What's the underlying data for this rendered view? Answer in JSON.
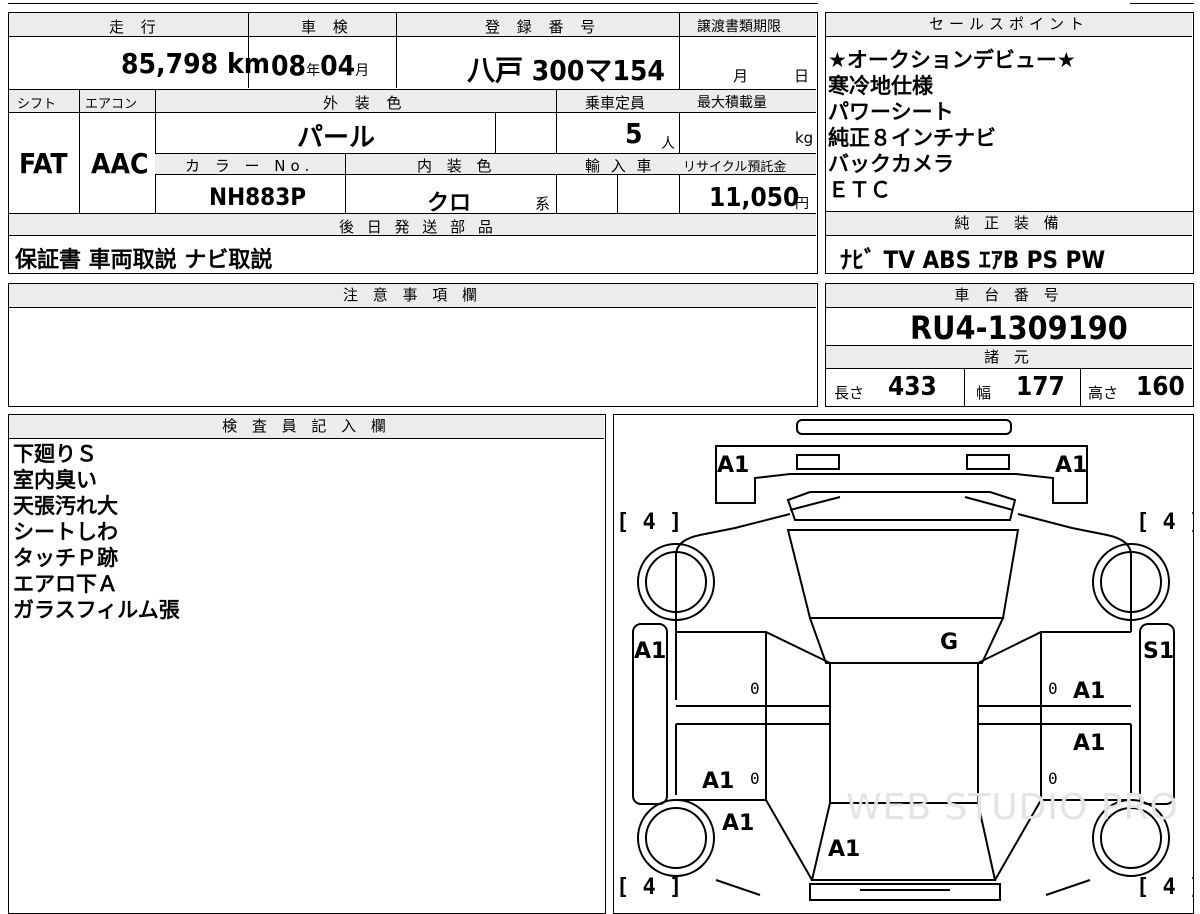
{
  "top_section": {
    "mileage": {
      "header": "走 行",
      "value": "85,798",
      "unit": "km"
    },
    "inspection": {
      "header": "車 検",
      "year": "08",
      "year_unit": "年",
      "month": "04",
      "month_unit": "月"
    },
    "registration": {
      "header": "登 録 番 号",
      "value": "八戸 300マ154"
    },
    "transfer_deadline": {
      "header": "譲渡書類期限",
      "month_unit": "月",
      "day_unit": "日"
    },
    "shift": {
      "header": "シフト",
      "value": "FAT"
    },
    "aircon": {
      "header": "エアコン",
      "value": "AAC"
    },
    "exterior_color": {
      "header": "外 装 色",
      "value": "パール"
    },
    "capacity": {
      "header": "乗車定員",
      "value": "5",
      "unit": "人"
    },
    "max_load": {
      "header": "最大積載量",
      "unit": "kg"
    },
    "color_no": {
      "header": "カ ラ ー No.",
      "value": "NH883P"
    },
    "interior_color": {
      "header": "内 装 色",
      "value": "クロ",
      "suffix": "系"
    },
    "import": {
      "header": "輸 入 車"
    },
    "recycle": {
      "header": "リサイクル預託金",
      "value": "11,050",
      "unit": "円"
    },
    "later_parts": {
      "header": "後 日 発 送 部 品",
      "value": "保証書 車両取説 ナビ取説"
    }
  },
  "sales_points": {
    "header": "セールスポイント",
    "items": [
      "★オークションデビュー★",
      "寒冷地仕様",
      "パワーシート",
      "純正８インチナビ",
      "バックカメラ",
      "ＥＴＣ"
    ]
  },
  "standard_equipment": {
    "header": "純 正 装 備",
    "value": "ﾅﾋﾞ TV ABS ｴｱB PS PW"
  },
  "notes": {
    "header": "注 意 事 項 欄",
    "value": ""
  },
  "chassis": {
    "header": "車 台 番 号",
    "value": "RU4-1309190"
  },
  "specs": {
    "header": "諸 元",
    "length_label": "長さ",
    "length": "433",
    "width_label": "幅",
    "width": "177",
    "height_label": "高さ",
    "height": "160"
  },
  "inspector": {
    "header": "検 査 員 記 入 欄",
    "items": [
      "下廻りＳ",
      "室内臭い",
      "天張汚れ大",
      "シートしわ",
      "タッチＰ跡",
      "エアロ下Ａ",
      "ガラスフィルム張"
    ]
  },
  "diagram": {
    "marks": {
      "front_left": "A1",
      "front_right": "A1",
      "tire_fl": "4",
      "tire_fr": "4",
      "tire_rl": "4",
      "tire_rr": "4",
      "roof": "G",
      "left_fender": "A1",
      "right_fender": "S1",
      "right_front_door": "A1",
      "right_rear_door": "A1",
      "left_rear_door": "A1",
      "left_rear_quarter": "A1",
      "rear": "A1",
      "zero": "0"
    },
    "watermark": "WEB STUDIO PRO"
  }
}
